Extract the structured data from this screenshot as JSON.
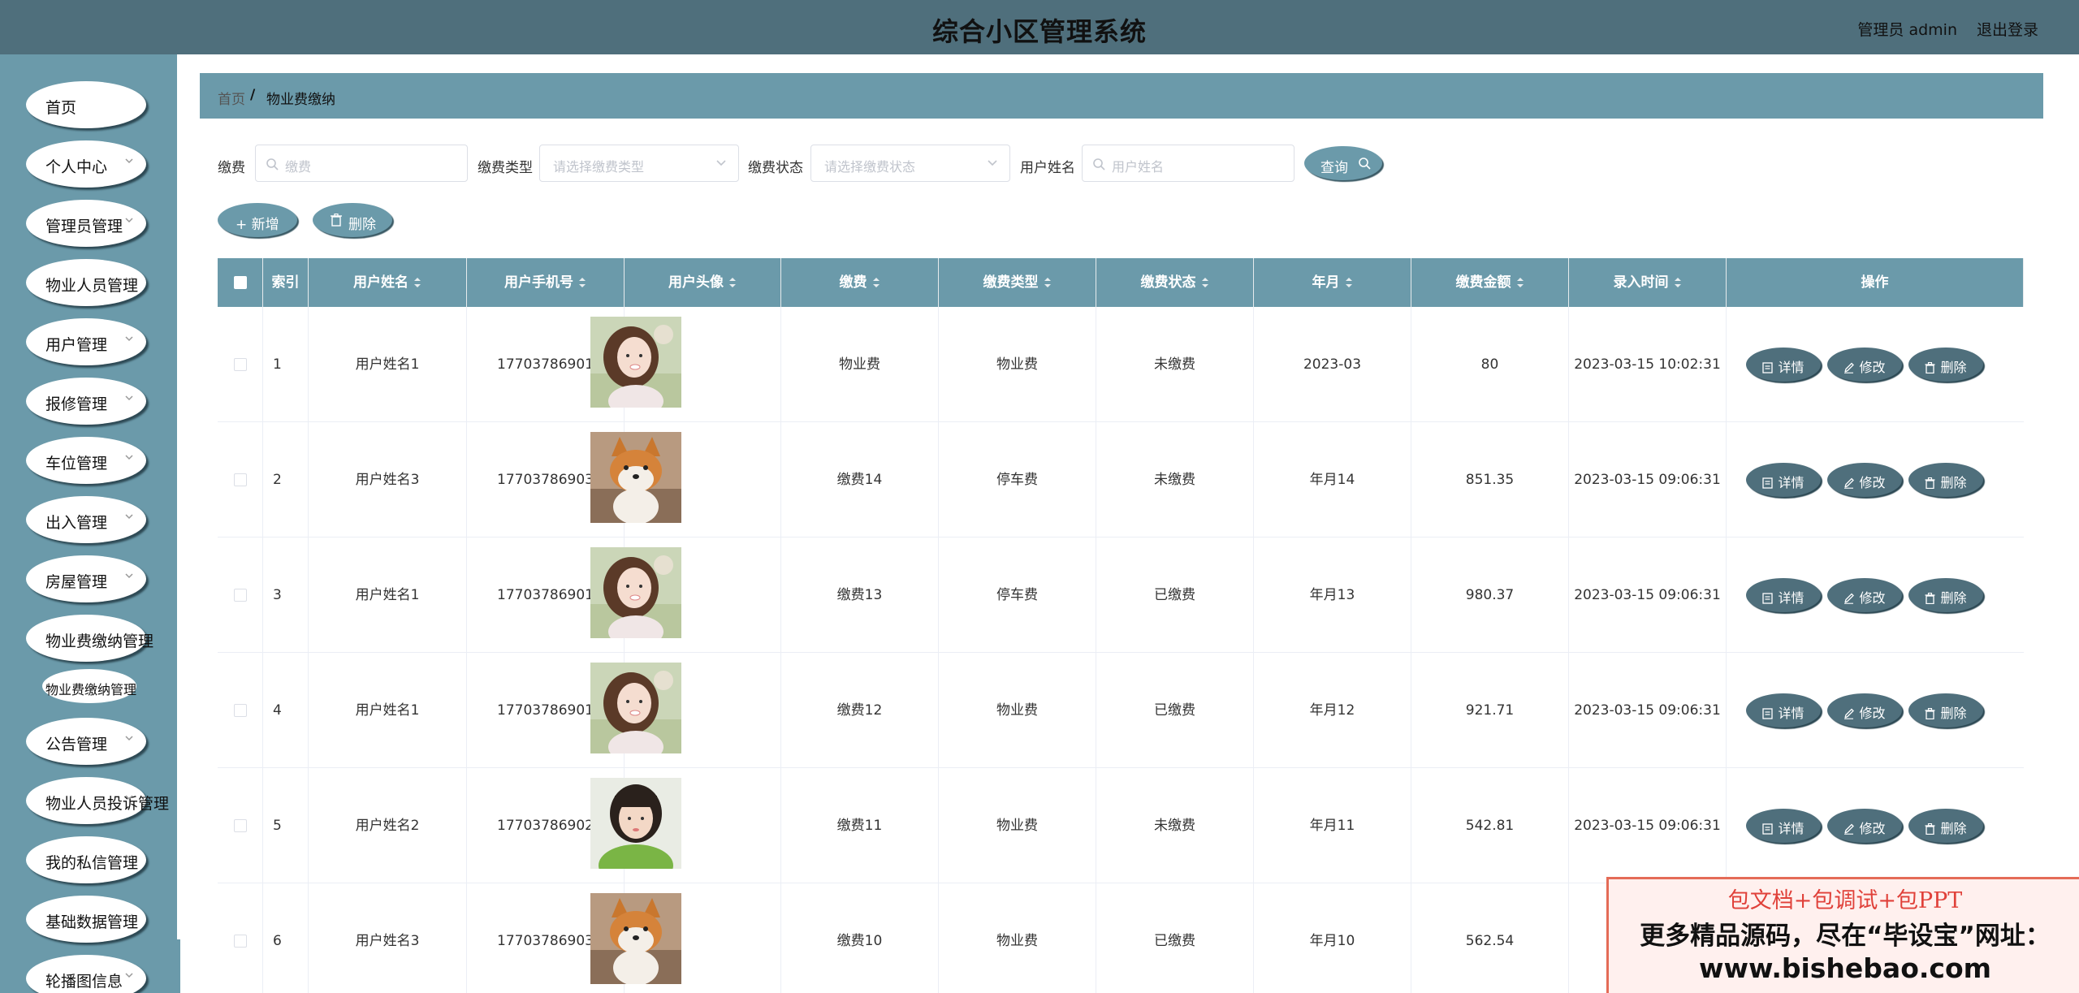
{
  "header": {
    "title": "综合小区管理系统",
    "user": "管理员 admin",
    "logout": "退出登录"
  },
  "sidebar": {
    "items": [
      {
        "label": "首页",
        "chevron": false
      },
      {
        "label": "个人中心",
        "chevron": true
      },
      {
        "label": "管理员管理",
        "chevron": true
      },
      {
        "label": "物业人员管理",
        "chevron": true
      },
      {
        "label": "用户管理",
        "chevron": true
      },
      {
        "label": "报修管理",
        "chevron": true
      },
      {
        "label": "车位管理",
        "chevron": true
      },
      {
        "label": "出入管理",
        "chevron": true
      },
      {
        "label": "房屋管理",
        "chevron": true
      },
      {
        "label": "物业费缴纳管理",
        "chevron": true
      },
      {
        "label": "公告管理",
        "chevron": true
      },
      {
        "label": "物业人员投诉管理",
        "chevron": true
      },
      {
        "label": "我的私信管理",
        "chevron": true
      },
      {
        "label": "基础数据管理",
        "chevron": true
      },
      {
        "label": "轮播图信息",
        "chevron": true
      }
    ],
    "sub_item": "物业费缴纳管理"
  },
  "breadcrumb": {
    "home": "首页",
    "sep": "/",
    "current": "物业费缴纳"
  },
  "search": {
    "fee_label": "缴费",
    "fee_placeholder": "缴费",
    "type_label": "缴费类型",
    "type_placeholder": "请选择缴费类型",
    "status_label": "缴费状态",
    "status_placeholder": "请选择缴费状态",
    "user_label": "用户姓名",
    "user_placeholder": "用户姓名",
    "query_button": "查询"
  },
  "actions": {
    "add_button": "+ 新增",
    "delete_button": "删除"
  },
  "table": {
    "headers": [
      "索引",
      "用户姓名",
      "用户手机号",
      "用户头像",
      "缴费",
      "缴费类型",
      "缴费状态",
      "年月",
      "缴费金额",
      "录入时间",
      "操作"
    ],
    "rows": [
      {
        "index": "1",
        "name": "用户姓名1",
        "phone": "17703786901",
        "avatar": "girl-1",
        "fee": "物业费",
        "type": "物业费",
        "status": "未缴费",
        "month": "2023-03",
        "amount": "80",
        "time": "2023-03-15 10:02:31"
      },
      {
        "index": "2",
        "name": "用户姓名3",
        "phone": "17703786903",
        "avatar": "dog",
        "fee": "缴费14",
        "type": "停车费",
        "status": "未缴费",
        "month": "年月14",
        "amount": "851.35",
        "time": "2023-03-15 09:06:31"
      },
      {
        "index": "3",
        "name": "用户姓名1",
        "phone": "17703786901",
        "avatar": "girl-1",
        "fee": "缴费13",
        "type": "停车费",
        "status": "已缴费",
        "month": "年月13",
        "amount": "980.37",
        "time": "2023-03-15 09:06:31"
      },
      {
        "index": "4",
        "name": "用户姓名1",
        "phone": "17703786901",
        "avatar": "girl-1",
        "fee": "缴费12",
        "type": "物业费",
        "status": "已缴费",
        "month": "年月12",
        "amount": "921.71",
        "time": "2023-03-15 09:06:31"
      },
      {
        "index": "5",
        "name": "用户姓名2",
        "phone": "17703786902",
        "avatar": "girl-2",
        "fee": "缴费11",
        "type": "物业费",
        "status": "未缴费",
        "month": "年月11",
        "amount": "542.81",
        "time": "2023-03-15 09:06:31"
      },
      {
        "index": "6",
        "name": "用户姓名3",
        "phone": "17703786903",
        "avatar": "dog",
        "fee": "缴费10",
        "type": "物业费",
        "status": "已缴费",
        "month": "年月10",
        "amount": "562.54",
        "time": ""
      }
    ],
    "op_buttons": {
      "detail": "详情",
      "edit": "修改",
      "delete": "删除"
    }
  },
  "promo": {
    "line1": "包文档+包调试+包PPT",
    "line2": "更多精品源码，尽在“毕设宝”网址：",
    "line3": "www.bishebao.com"
  },
  "colors": {
    "header_bg": "#4f6f7c",
    "sidebar_bg": "#6b9aaa",
    "accent": "#6b9aaa",
    "op_button": "#4f6f7c",
    "promo_red": "#e0413a"
  }
}
